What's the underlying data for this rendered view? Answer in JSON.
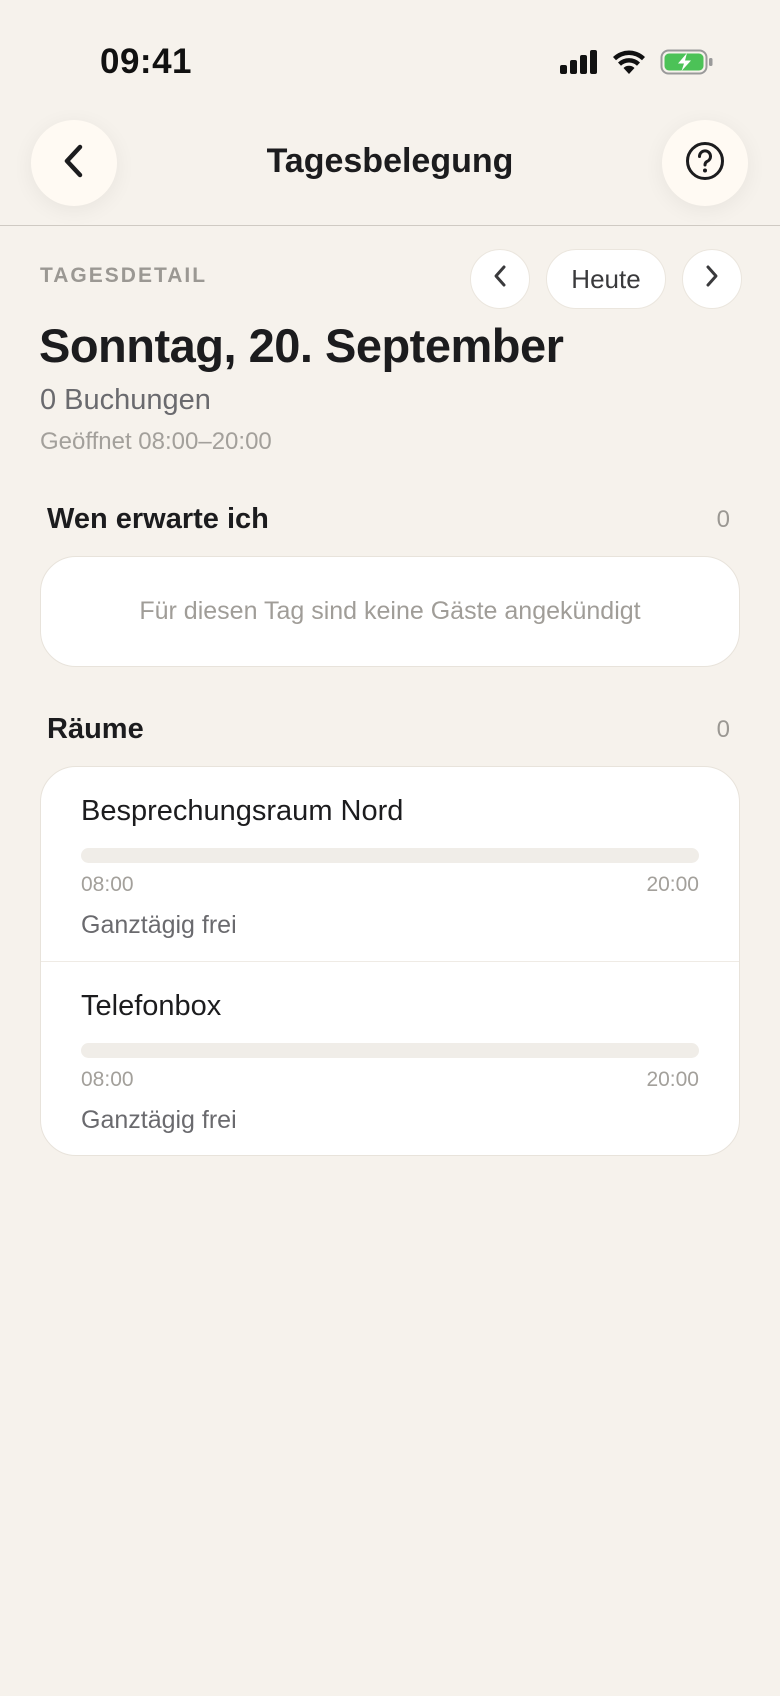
{
  "status_bar": {
    "time": "09:41"
  },
  "nav": {
    "title": "Tagesbelegung"
  },
  "day_detail": {
    "kicker": "TAGESDETAIL",
    "today_label": "Heute",
    "date_title": "Sonntag, 20. September",
    "bookings": "0 Buchungen",
    "opening_hours": "Geöffnet 08:00–20:00"
  },
  "guests": {
    "label": "Wen erwarte ich",
    "count": "0",
    "empty_text": "Für diesen Tag sind keine Gäste angekündigt"
  },
  "rooms": {
    "label": "Räume",
    "count": "0",
    "items": [
      {
        "name": "Besprechungsraum Nord",
        "start": "08:00",
        "end": "20:00",
        "occupied_fraction": 0,
        "status": "Ganztägig frei"
      },
      {
        "name": "Telefonbox",
        "start": "08:00",
        "end": "20:00",
        "occupied_fraction": 0,
        "status": "Ganztägig frei"
      }
    ]
  },
  "colors": {
    "background": "#f6f2ec",
    "card": "#ffffff",
    "battery_green": "#4cc257",
    "text_primary": "#1c1c1e",
    "text_muted": "#a3a09b"
  }
}
